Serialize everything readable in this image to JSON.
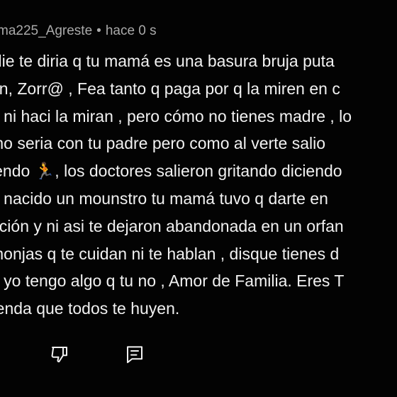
{
  "comment": {
    "author": "ma225_Agreste",
    "separator": "•",
    "timestamp": "hace 0 s",
    "lines": [
      "ylie te diria q tu mamá es una basura bruja puta",
      "an,  Zorr@ , Fea tanto q paga por q la miren en c",
      "o ni haci la miran , pero cómo no tienes madre , lo",
      "mo seria con tu padre pero como al verte salio",
      "iendo 🏃, los doctores salieron gritando diciendo",
      "a nacido un mounstro  tu mamá tuvo q darte en",
      "oción y ni asi te dejaron abandonada en un orfan",
      "monjas q te cuidan ni te hablan , disque tienes d",
      "o yo tengo algo q tu no , Amor de Familia. Eres T",
      "renda que todos te huyen."
    ]
  },
  "actions": {
    "dislike_icon": "thumbs-down-icon",
    "reply_icon": "reply-comment-icon"
  },
  "colors": {
    "background": "#030303",
    "text": "#f1f1f1",
    "meta_text": "#aaaaaa",
    "icon": "#f1f1f1"
  }
}
